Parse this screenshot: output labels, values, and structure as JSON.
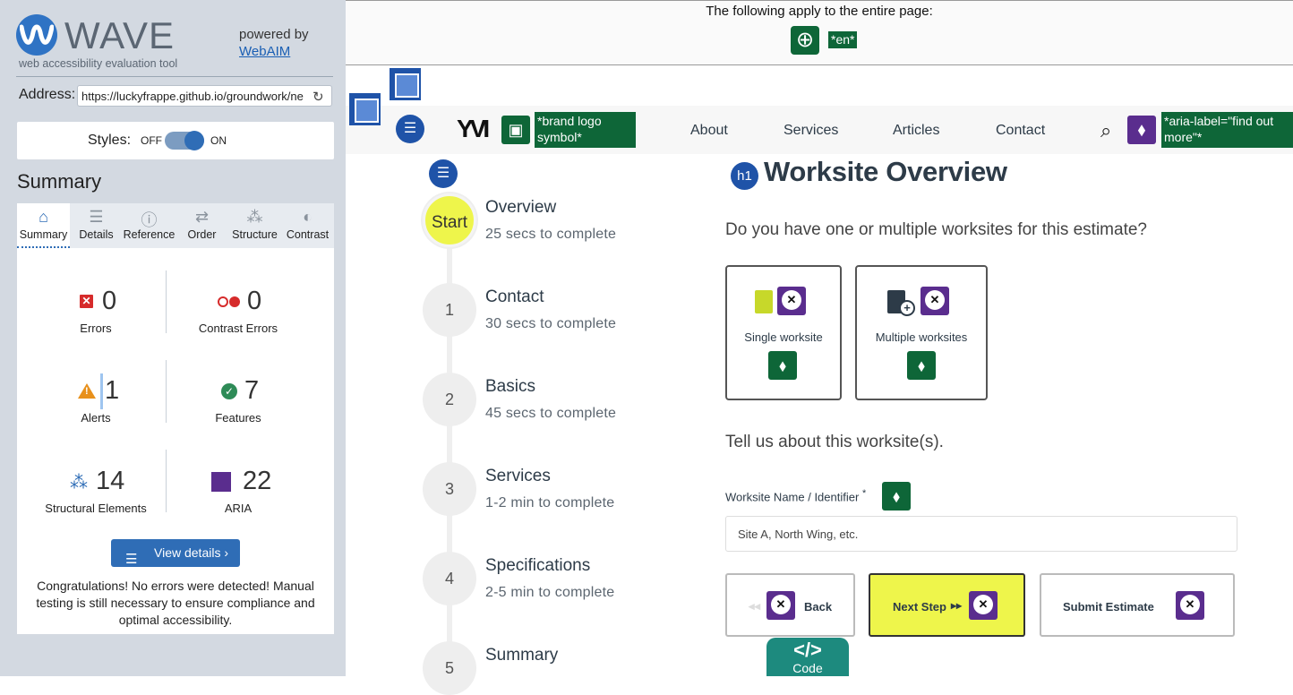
{
  "wave": {
    "logo_text": "WAVE",
    "tagline": "web accessibility evaluation tool",
    "powered_by": "powered by",
    "webaim": "WebAIM",
    "address_label": "Address:",
    "address_value": "https://luckyfrappe.github.io/groundwork/ne",
    "styles_label": "Styles:",
    "styles_off": "OFF",
    "styles_on": "ON",
    "summary_heading": "Summary",
    "tabs": [
      {
        "label": "Summary",
        "icon": "home-icon",
        "glyph": "⌂"
      },
      {
        "label": "Details",
        "icon": "list-icon",
        "glyph": "☰"
      },
      {
        "label": "Reference",
        "icon": "info-icon",
        "glyph": "ⓘ"
      },
      {
        "label": "Order",
        "icon": "order-icon",
        "glyph": "⇄"
      },
      {
        "label": "Structure",
        "icon": "structure-icon",
        "glyph": "⁂"
      },
      {
        "label": "Contrast",
        "icon": "contrast-icon",
        "glyph": "◐"
      }
    ],
    "stats": {
      "errors": {
        "value": "0",
        "label": "Errors"
      },
      "contrast": {
        "value": "0",
        "label": "Contrast Errors"
      },
      "alerts": {
        "value": "1",
        "label": "Alerts"
      },
      "features": {
        "value": "7",
        "label": "Features"
      },
      "structural": {
        "value": "14",
        "label": "Structural Elements"
      },
      "aria": {
        "value": "22",
        "label": "ARIA"
      }
    },
    "view_details": "View details ›",
    "congrats": "Congratulations! No errors were detected! Manual testing is still necessary to ensure compliance and optimal accessibility."
  },
  "page": {
    "top_note": "The following apply to the entire page:",
    "lang_tag": "*en*",
    "brand_tag": "*brand logo symbol*",
    "aria_tag": "*aria-label=\"find out more\"*",
    "nav": [
      "About",
      "Services",
      "Articles",
      "Contact"
    ],
    "steps": [
      {
        "badge": "Start",
        "title": "Overview",
        "sub": "25 secs to complete"
      },
      {
        "badge": "1",
        "title": "Contact",
        "sub": "30 secs to complete"
      },
      {
        "badge": "2",
        "title": "Basics",
        "sub": "45 secs to complete"
      },
      {
        "badge": "3",
        "title": "Services",
        "sub": "1-2 min to complete"
      },
      {
        "badge": "4",
        "title": "Specifications",
        "sub": "2-5 min to complete"
      },
      {
        "badge": "5",
        "title": "Summary",
        "sub": ""
      }
    ],
    "h1_badge": "h1",
    "heading": "Worksite Overview",
    "question": "Do you have one or multiple worksites for this estimate?",
    "options": [
      "Single worksite",
      "Multiple worksites"
    ],
    "tell": "Tell us about this worksite(s).",
    "field_label": "Worksite Name / Identifier",
    "field_required": "*",
    "field_placeholder": "Site A, North Wing, etc.",
    "buttons": {
      "back": "Back",
      "next": "Next Step",
      "submit": "Submit Estimate"
    },
    "code_label": "Code",
    "code_glyph": "</>"
  },
  "colors": {
    "wave_blue": "#2f6db6",
    "aria_purple": "#5a2d8e",
    "feature_green": "#0e6638",
    "accent_yellow": "#eef54b"
  }
}
